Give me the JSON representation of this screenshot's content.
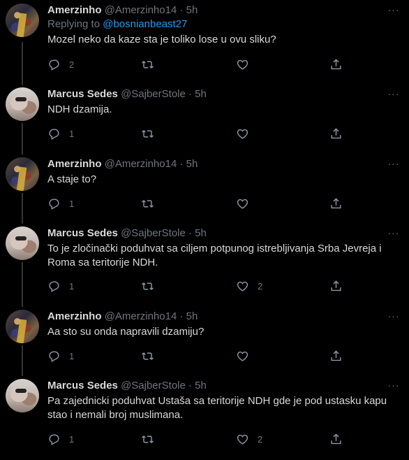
{
  "tweets": [
    {
      "name": "Amerzinho",
      "handle": "@Amerzinho14",
      "time": "· 5h",
      "replying_prefix": "Replying to",
      "replying_to": "@bosnianbeast27",
      "text": "Mozel neko da kaze sta je toliko lose u ovu sliku?",
      "reply_count": "2",
      "retweet_count": "",
      "like_count": "",
      "avatar": "amerzinho-avatar"
    },
    {
      "name": "Marcus Sedes",
      "handle": "@SajberStole",
      "time": "· 5h",
      "text": "NDH dzamija.",
      "reply_count": "1",
      "retweet_count": "",
      "like_count": "",
      "avatar": "marcus-avatar"
    },
    {
      "name": "Amerzinho",
      "handle": "@Amerzinho14",
      "time": "· 5h",
      "text": "A staje to?",
      "reply_count": "1",
      "retweet_count": "",
      "like_count": "",
      "avatar": "amerzinho-avatar"
    },
    {
      "name": "Marcus Sedes",
      "handle": "@SajberStole",
      "time": "· 5h",
      "text": "To je zločinački poduhvat sa ciljem potpunog istrebljivanja Srba Jevreja i Roma sa teritorije NDH.",
      "reply_count": "1",
      "retweet_count": "",
      "like_count": "2",
      "avatar": "marcus-avatar"
    },
    {
      "name": "Amerzinho",
      "handle": "@Amerzinho14",
      "time": "· 5h",
      "text": "Aa sto su onda napravili dzamiju?",
      "reply_count": "1",
      "retweet_count": "",
      "like_count": "",
      "avatar": "amerzinho-avatar"
    },
    {
      "name": "Marcus Sedes",
      "handle": "@SajberStole",
      "time": "· 5h",
      "text": "Pa zajednicki poduhvat Ustaša sa teritorije NDH gde je pod ustasku kapu stao i nemali broj muslimana.",
      "reply_count": "1",
      "retweet_count": "",
      "like_count": "2",
      "avatar": "marcus-avatar"
    }
  ],
  "icons": {
    "reply": "reply-icon",
    "retweet": "retweet-icon",
    "like": "heart-icon",
    "share": "share-icon",
    "more": "more-icon"
  },
  "colors": {
    "background": "#000000",
    "text": "#d9d9d9",
    "muted": "#6e767d",
    "link": "#1d9bf0",
    "thread_line": "#333639"
  }
}
